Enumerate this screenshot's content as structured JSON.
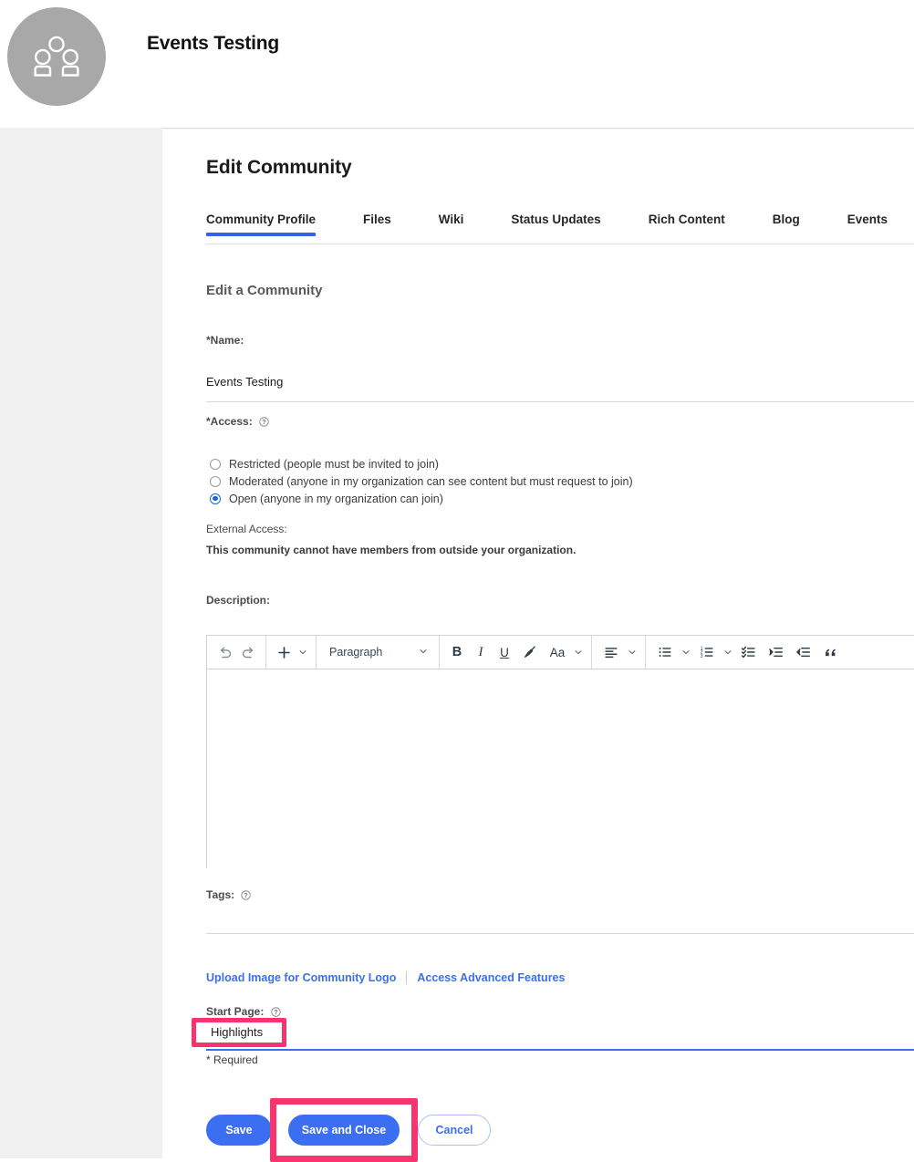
{
  "header": {
    "avatar_icon": "group-people-icon",
    "community_title": "Events Testing"
  },
  "page": {
    "title": "Edit Community",
    "subheading": "Edit a Community"
  },
  "tabs": [
    {
      "label": "Community Profile",
      "active": true
    },
    {
      "label": "Files",
      "active": false
    },
    {
      "label": "Wiki",
      "active": false
    },
    {
      "label": "Status Updates",
      "active": false
    },
    {
      "label": "Rich Content",
      "active": false
    },
    {
      "label": "Blog",
      "active": false
    },
    {
      "label": "Events",
      "active": false
    }
  ],
  "form": {
    "name": {
      "label": "*Name:",
      "value": "Events Testing"
    },
    "access": {
      "label": "*Access:",
      "help_icon": "question-mark-icon",
      "options": [
        {
          "label": "Restricted (people must be invited to join)",
          "selected": false
        },
        {
          "label": "Moderated (anyone in my organization can see content but must request to join)",
          "selected": false
        },
        {
          "label": "Open (anyone in my organization can join)",
          "selected": true
        }
      ]
    },
    "external_access": {
      "label": "External Access:",
      "text": "This community cannot have members from outside your organization."
    },
    "description": {
      "label": "Description:",
      "value": "",
      "toolbar": {
        "undo": "undo-icon",
        "redo": "redo-icon",
        "insert": "plus-icon",
        "insert_caret": "chevron-down-icon",
        "paragraph_style": "Paragraph",
        "paragraph_caret": "chevron-down-icon",
        "bold": "B",
        "italic": "I",
        "underline": "U",
        "highlight": "highlighter-icon",
        "font_style": "Aa",
        "font_caret": "chevron-down-icon",
        "align": "align-left-icon",
        "align_caret": "chevron-down-icon",
        "bullet_list": "bulleted-list-icon",
        "bullet_caret": "chevron-down-icon",
        "numbered_list": "numbered-list-icon",
        "numbered_caret": "chevron-down-icon",
        "checklist": "checklist-icon",
        "indent": "indent-increase-icon",
        "outdent": "indent-decrease-icon",
        "quote": "blockquote-icon"
      }
    },
    "tags": {
      "label": "Tags:",
      "help_icon": "question-mark-icon",
      "value": ""
    },
    "start_page": {
      "label": "Start Page:",
      "help_icon": "question-mark-icon",
      "value": "Highlights",
      "highlighted": true
    },
    "required_note": "* Required"
  },
  "links": [
    {
      "label": "Upload Image for Community Logo"
    },
    {
      "label": "Access Advanced Features"
    }
  ],
  "actions": {
    "save": "Save",
    "save_and_close": "Save and Close",
    "cancel": "Cancel"
  },
  "colors": {
    "accent_blue": "#3b6ef0",
    "tab_underline": "#2f64e3",
    "highlight_pink": "#f6356f",
    "avatar_gray": "#a8a8a8",
    "page_bg": "#f0f0f0"
  }
}
